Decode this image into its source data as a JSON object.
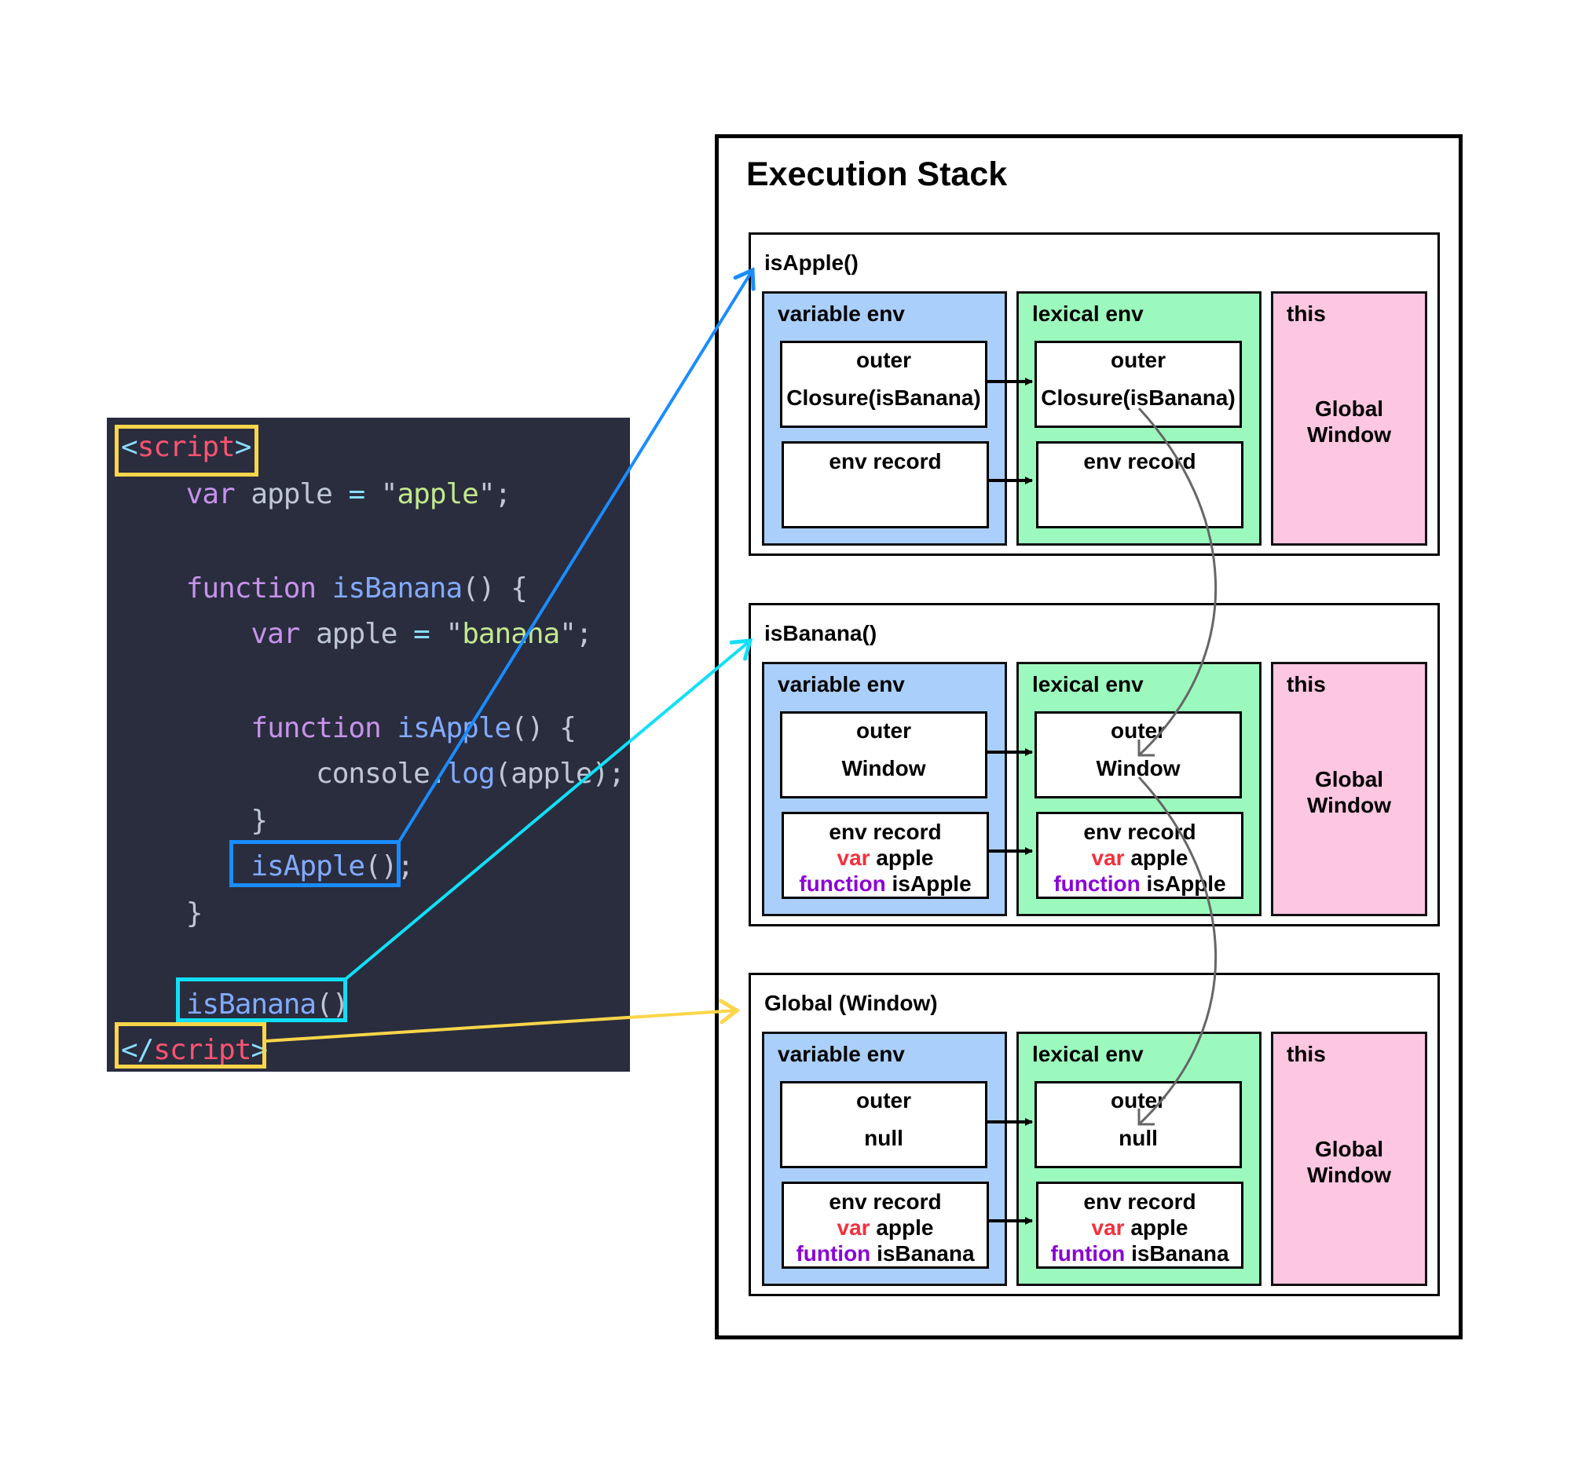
{
  "code": {
    "lines": [
      [
        {
          "t": "<",
          "c": "br"
        },
        {
          "t": "script",
          "c": "tag"
        },
        {
          "t": ">",
          "c": "br"
        }
      ],
      [
        {
          "t": "    var",
          "c": "kw"
        },
        {
          "t": " apple ",
          "c": "pl"
        },
        {
          "t": "=",
          "c": "br"
        },
        {
          "t": " \"",
          "c": "pl"
        },
        {
          "t": "apple",
          "c": "str"
        },
        {
          "t": "\";",
          "c": "pl"
        }
      ],
      [],
      [
        {
          "t": "    function",
          "c": "kw"
        },
        {
          "t": " isBanana",
          "c": "fn"
        },
        {
          "t": "() {",
          "c": "pl"
        }
      ],
      [
        {
          "t": "        var",
          "c": "kw"
        },
        {
          "t": " apple ",
          "c": "pl"
        },
        {
          "t": "=",
          "c": "br"
        },
        {
          "t": " \"",
          "c": "pl"
        },
        {
          "t": "banana",
          "c": "str"
        },
        {
          "t": "\";",
          "c": "pl"
        }
      ],
      [],
      [
        {
          "t": "        function",
          "c": "kw"
        },
        {
          "t": " isApple",
          "c": "fn"
        },
        {
          "t": "() {",
          "c": "pl"
        }
      ],
      [
        {
          "t": "            console",
          "c": "pl"
        },
        {
          "t": ".",
          "c": "br"
        },
        {
          "t": "log",
          "c": "fn"
        },
        {
          "t": "(apple);",
          "c": "pl"
        }
      ],
      [
        {
          "t": "        }",
          "c": "pl"
        }
      ],
      [
        {
          "t": "        isApple",
          "c": "fn"
        },
        {
          "t": "();",
          "c": "pl"
        }
      ],
      [
        {
          "t": "    }",
          "c": "pl"
        }
      ],
      [],
      [
        {
          "t": "    isBanana",
          "c": "fn"
        },
        {
          "t": "()",
          "c": "pl"
        }
      ],
      [
        {
          "t": "</",
          "c": "br"
        },
        {
          "t": "script",
          "c": "tag"
        },
        {
          "t": ">",
          "c": "br"
        }
      ]
    ],
    "highlights": [
      {
        "name": "script-open-highlight",
        "color": "#fdd54a"
      },
      {
        "name": "isapple-call-highlight",
        "color": "#1a8cff"
      },
      {
        "name": "isbanana-call-highlight",
        "color": "#10e0f7"
      },
      {
        "name": "script-close-highlight",
        "color": "#fdd54a"
      }
    ]
  },
  "stack": {
    "title": "Execution Stack",
    "contexts": [
      {
        "title": "isApple()",
        "variable_env": {
          "label": "variable env",
          "outer_label": "outer",
          "outer_value": "Closure(isBanana)",
          "record_label": "env record",
          "record_items": []
        },
        "lexical_env": {
          "label": "lexical env",
          "outer_label": "outer",
          "outer_value": "Closure(isBanana)",
          "record_label": "env record",
          "record_items": []
        },
        "this": {
          "label": "this",
          "value_line1": "Global",
          "value_line2": "Window"
        }
      },
      {
        "title": "isBanana()",
        "variable_env": {
          "label": "variable env",
          "outer_label": "outer",
          "outer_value": "Window",
          "record_label": "env record",
          "record_items": [
            {
              "kw": "var",
              "kw_color": "red",
              "name": "apple"
            },
            {
              "kw": "function",
              "kw_color": "purple",
              "name": "isApple"
            }
          ]
        },
        "lexical_env": {
          "label": "lexical env",
          "outer_label": "outer",
          "outer_value": "Window",
          "record_label": "env record",
          "record_items": [
            {
              "kw": "var",
              "kw_color": "red",
              "name": "apple"
            },
            {
              "kw": "function",
              "kw_color": "purple",
              "name": "isApple"
            }
          ]
        },
        "this": {
          "label": "this",
          "value_line1": "Global",
          "value_line2": "Window"
        }
      },
      {
        "title": "Global (Window)",
        "variable_env": {
          "label": "variable env",
          "outer_label": "outer",
          "outer_value": "null",
          "record_label": "env record",
          "record_items": [
            {
              "kw": "var",
              "kw_color": "red",
              "name": "apple"
            },
            {
              "kw": "funtion",
              "kw_color": "purple",
              "name": "isBanana"
            }
          ]
        },
        "lexical_env": {
          "label": "lexical env",
          "outer_label": "outer",
          "outer_value": "null",
          "record_label": "env record",
          "record_items": [
            {
              "kw": "var",
              "kw_color": "red",
              "name": "apple"
            },
            {
              "kw": "funtion",
              "kw_color": "purple",
              "name": "isBanana"
            }
          ]
        },
        "this": {
          "label": "this",
          "value_line1": "Global",
          "value_line2": "Window"
        }
      }
    ]
  },
  "colors": {
    "code_bg": "#292d3e",
    "variable_env": "#aacffb",
    "lexical_env": "#9cf9bd",
    "this": "#fdc6e1",
    "arrow_isapple": "#1a8cff",
    "arrow_isbanana": "#10e0f7",
    "arrow_global": "#fdd54a",
    "outer_chain_arrow": "#666666"
  }
}
